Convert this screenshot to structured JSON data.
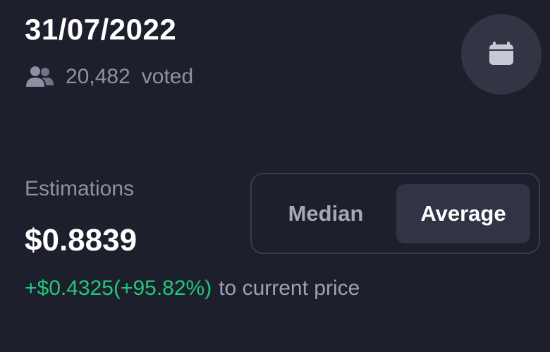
{
  "header": {
    "date": "31/07/2022",
    "votes_count": "20,482",
    "votes_label": "voted"
  },
  "estimation": {
    "label": "Estimations",
    "value": "$0.8839",
    "delta": "+$0.4325(+95.82%)",
    "delta_suffix": "to current price"
  },
  "toggle": {
    "options": [
      "Median",
      "Average"
    ],
    "selected": "Average"
  },
  "icons": {
    "votes": "users-icon",
    "calendar": "calendar-icon"
  },
  "colors": {
    "background": "#1e1f2c",
    "positive": "#1fc97a",
    "muted_text": "#8e91a3",
    "selected_pill": "#323445"
  }
}
